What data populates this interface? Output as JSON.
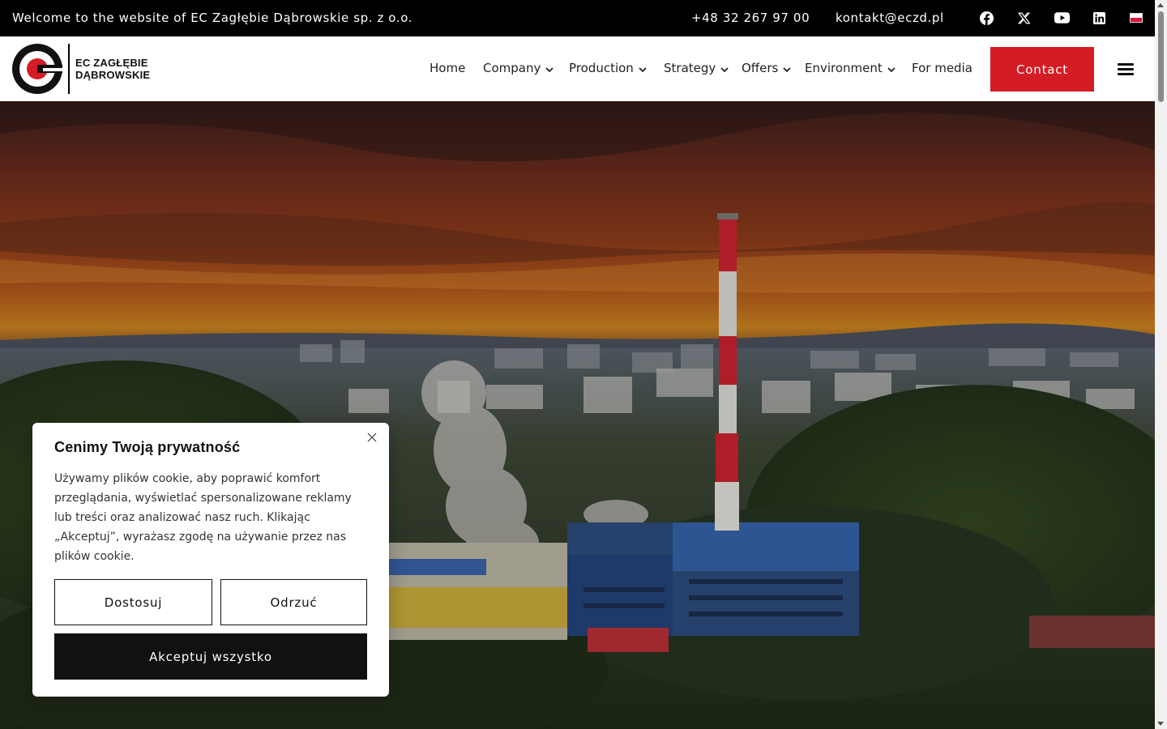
{
  "topbar": {
    "welcome": "Welcome to the website of EC Zagłębie Dąbrowskie sp. z o.o.",
    "phone": "+48 32 267 97 00",
    "email": "kontakt@eczd.pl",
    "social_icons": [
      "facebook-icon",
      "x-icon",
      "youtube-icon",
      "linkedin-icon"
    ],
    "language_flag": "polish-flag-icon"
  },
  "header": {
    "logo_line1": "EC ZAGŁĘBIE",
    "logo_line2": "DĄBROWSKIE",
    "nav": [
      {
        "label": "Home",
        "has_dropdown": false
      },
      {
        "label": "Company",
        "has_dropdown": true
      },
      {
        "label": "Production",
        "has_dropdown": true
      },
      {
        "label": "Strategy",
        "has_dropdown": true
      },
      {
        "label": "Offers",
        "has_dropdown": true
      },
      {
        "label": "Environment",
        "has_dropdown": true
      },
      {
        "label": "For media",
        "has_dropdown": false
      }
    ],
    "contact_label": "Contact",
    "menu_icon": "hamburger-menu-icon"
  },
  "cookie": {
    "title": "Cenimy Twoją prywatność",
    "text": "Używamy plików cookie, aby poprawić komfort przeglądania, wyświetlać spersonalizowane reklamy lub treści oraz analizować nasz ruch. Klikając „Akceptuj”, wyrażasz zgodę na używanie przez nas plików cookie.",
    "customize_label": "Dostosuj",
    "reject_label": "Odrzuć",
    "accept_label": "Akceptuj wszystko"
  },
  "colors": {
    "brand_red": "#d41c24",
    "topbar_bg": "#000000",
    "dark_button": "#111111"
  }
}
